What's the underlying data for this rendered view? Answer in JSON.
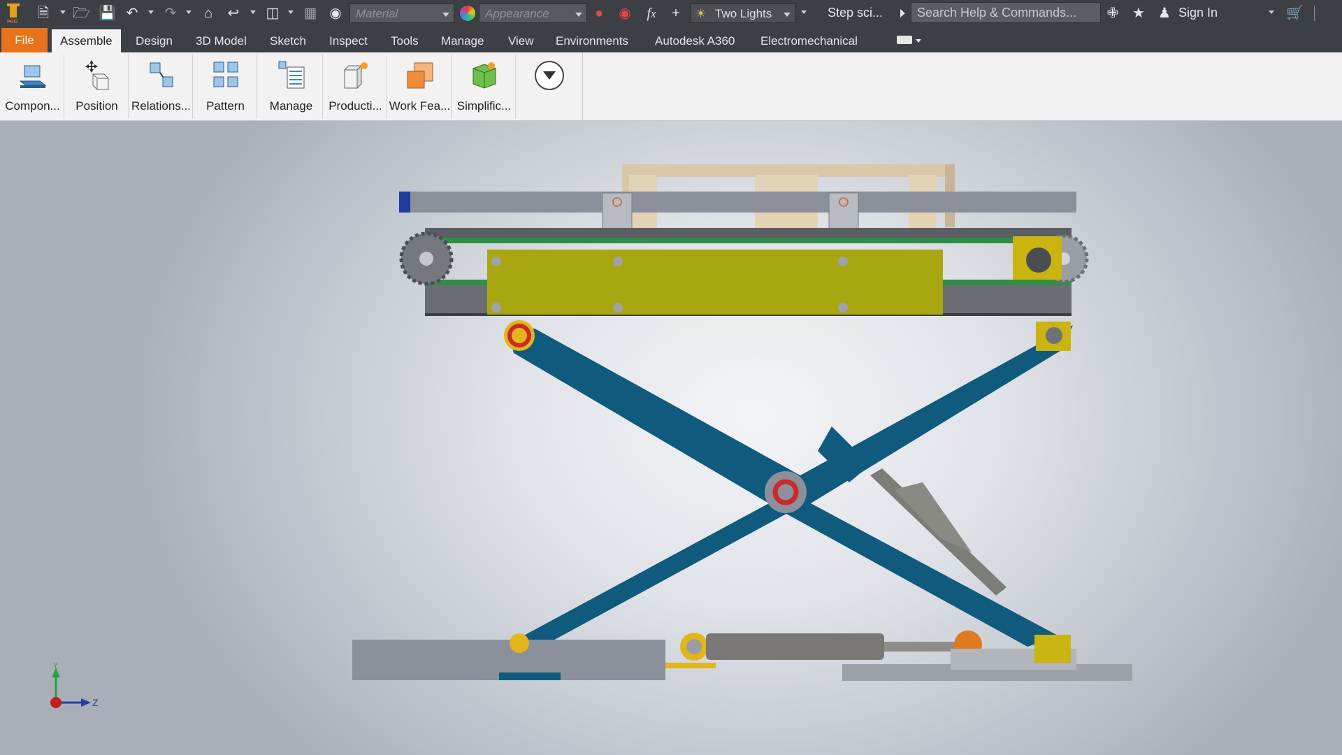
{
  "quick_access": {
    "material_placeholder": "Material",
    "appearance_placeholder": "Appearance",
    "lighting_label": "Two Lights",
    "doc_name": "Step sci...",
    "search_placeholder": "Search Help & Commands...",
    "sign_in": "Sign In",
    "icons": [
      "inventor-pro-logo",
      "new-icon",
      "open-icon",
      "save-icon",
      "undo-icon",
      "redo-icon",
      "home-icon",
      "return-icon",
      "select-icon",
      "measure-icon",
      "material-icon",
      "appearance-icon",
      "clear-appearance-icon",
      "parameters-icon",
      "add-icon",
      "lighting-icon",
      "help-icon",
      "favorites-icon",
      "user-icon",
      "cart-icon"
    ]
  },
  "tabs": [
    {
      "label": "File",
      "state": "file"
    },
    {
      "label": "Assemble",
      "state": "active"
    },
    {
      "label": "Design"
    },
    {
      "label": "3D Model"
    },
    {
      "label": "Sketch"
    },
    {
      "label": "Inspect"
    },
    {
      "label": "Tools"
    },
    {
      "label": "Manage"
    },
    {
      "label": "View"
    },
    {
      "label": "Environments"
    },
    {
      "label": "Autodesk A360"
    },
    {
      "label": "Electromechanical"
    }
  ],
  "ribbon": {
    "buttons": [
      {
        "label": "Compon...",
        "icon": "component-icon"
      },
      {
        "label": "Position",
        "icon": "position-icon"
      },
      {
        "label": "Relations...",
        "icon": "relationships-icon"
      },
      {
        "label": "Pattern",
        "icon": "pattern-icon"
      },
      {
        "label": "Manage",
        "icon": "manage-icon"
      },
      {
        "label": "Producti...",
        "icon": "productivity-icon"
      },
      {
        "label": "Work Fea...",
        "icon": "work-features-icon"
      },
      {
        "label": "Simplific...",
        "icon": "simplification-icon"
      }
    ],
    "overflow_icon": "panel-dropdown-icon"
  },
  "viewport": {
    "model": "scissor lift assembly",
    "colors": {
      "arms": "#0f5a7d",
      "platform_plate": "#a8a712",
      "rail": "#8c909a",
      "pivot_ring": "#cc2a2a",
      "pivot_collar": "#e2b51a",
      "background_center": "#f3f4f6",
      "background_edge": "#a9afb9"
    },
    "triad": {
      "y_label": "Y",
      "z_label": "Z"
    }
  },
  "accent": {
    "file_tab": "#e8731a",
    "dark_bar": "#3c3f44",
    "ribbon_bg": "#f2f2f2"
  }
}
